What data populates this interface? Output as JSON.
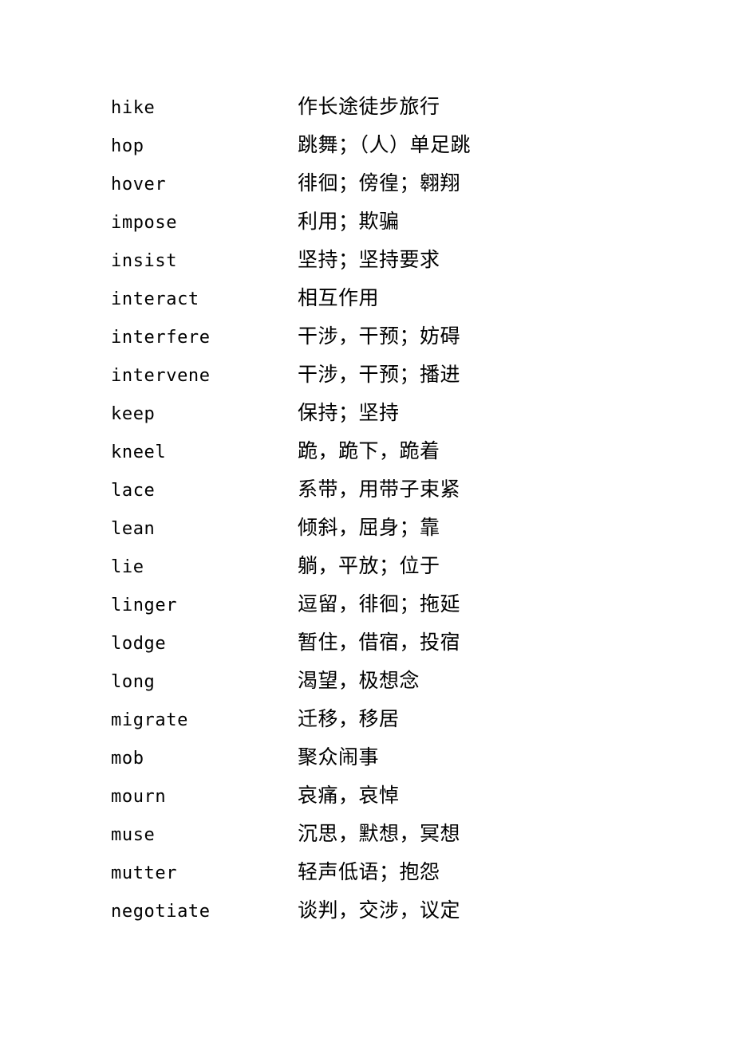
{
  "document": {
    "type": "vocabulary-list",
    "language_pair": "English-Chinese",
    "background_color": "#ffffff",
    "text_color": "#000000"
  },
  "entries": [
    {
      "term": "hike",
      "definition": "作长途徒步旅行"
    },
    {
      "term": "hop",
      "definition": "跳舞；（人）单足跳"
    },
    {
      "term": "hover",
      "definition": "徘徊；傍徨；翱翔"
    },
    {
      "term": "impose",
      "definition": "利用；欺骗"
    },
    {
      "term": "insist",
      "definition": "坚持；坚持要求"
    },
    {
      "term": "interact",
      "definition": "相互作用"
    },
    {
      "term": "interfere",
      "definition": "干涉，干预；妨碍"
    },
    {
      "term": "intervene",
      "definition": "干涉，干预；播进"
    },
    {
      "term": "keep",
      "definition": "保持；坚持"
    },
    {
      "term": "kneel",
      "definition": "跪，跪下，跪着"
    },
    {
      "term": "lace",
      "definition": "系带，用带子束紧"
    },
    {
      "term": "lean",
      "definition": "倾斜，屈身；靠"
    },
    {
      "term": "lie",
      "definition": "躺，平放；位于"
    },
    {
      "term": "linger",
      "definition": "逗留，徘徊；拖延"
    },
    {
      "term": "lodge",
      "definition": "暂住，借宿，投宿"
    },
    {
      "term": "long",
      "definition": "渴望，极想念"
    },
    {
      "term": "migrate",
      "definition": "迁移，移居"
    },
    {
      "term": "mob",
      "definition": "聚众闹事"
    },
    {
      "term": "mourn",
      "definition": "哀痛，哀悼"
    },
    {
      "term": "muse",
      "definition": "沉思，默想，冥想"
    },
    {
      "term": "mutter",
      "definition": "轻声低语；抱怨"
    },
    {
      "term": "negotiate",
      "definition": "谈判，交涉，议定"
    }
  ]
}
